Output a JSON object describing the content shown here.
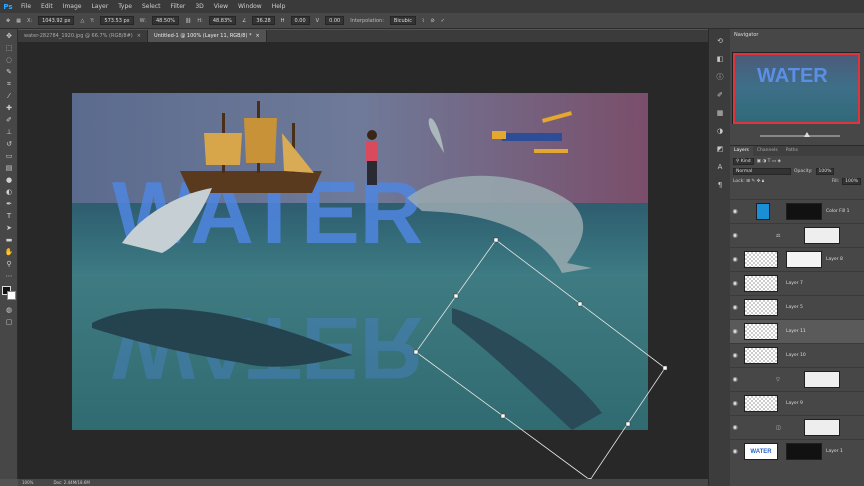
{
  "app": {
    "logo": "Ps"
  },
  "menu": [
    "File",
    "Edit",
    "Image",
    "Layer",
    "Type",
    "Select",
    "Filter",
    "3D",
    "View",
    "Window",
    "Help"
  ],
  "options": {
    "x_label": "X:",
    "x_value": "1043.92 px",
    "y_label": "Y:",
    "y_value": "573.53 px",
    "w_label": "W:",
    "w_value": "48.50%",
    "h_label": "H:",
    "h_value": "48.83%",
    "angle_value": "36.28",
    "hskew_value": "0.00",
    "vskew_value": "0.00",
    "interp_label": "Interpolation:",
    "interp_value": "Bicubic"
  },
  "tabs": [
    {
      "label": "water-282784_1920.jpg @ 66.7% (RGB/8#)"
    },
    {
      "label": "Untitled-1 @ 100% (Layer 11, RGB/8) *"
    }
  ],
  "canvas": {
    "title_text": "WATER"
  },
  "status": {
    "zoom": "100%",
    "doc": "Doc: 2.44M/18.6M"
  },
  "navigator": {
    "title": "Navigator",
    "thumb_text": "WATER"
  },
  "layers_panel": {
    "tabs": [
      "Layers",
      "Channels",
      "Paths"
    ],
    "blend_mode": "Normal",
    "opacity_label": "Opacity:",
    "opacity_value": "100%",
    "fill_label": "Fill:",
    "fill_value": "100%",
    "layers": [
      {
        "name": "Color Fill 1"
      },
      {
        "name": ""
      },
      {
        "name": "Layer 8"
      },
      {
        "name": "Layer 7"
      },
      {
        "name": "Layer 5"
      },
      {
        "name": "Layer 11"
      },
      {
        "name": "Layer 10"
      },
      {
        "name": ""
      },
      {
        "name": "Layer 9"
      },
      {
        "name": ""
      },
      {
        "name": "Layer 1"
      }
    ],
    "thumb_text": "WATER"
  },
  "colors": {
    "accent": "#31a8ff",
    "nav_box": "#e0333b",
    "letters": "#4f86e0"
  }
}
